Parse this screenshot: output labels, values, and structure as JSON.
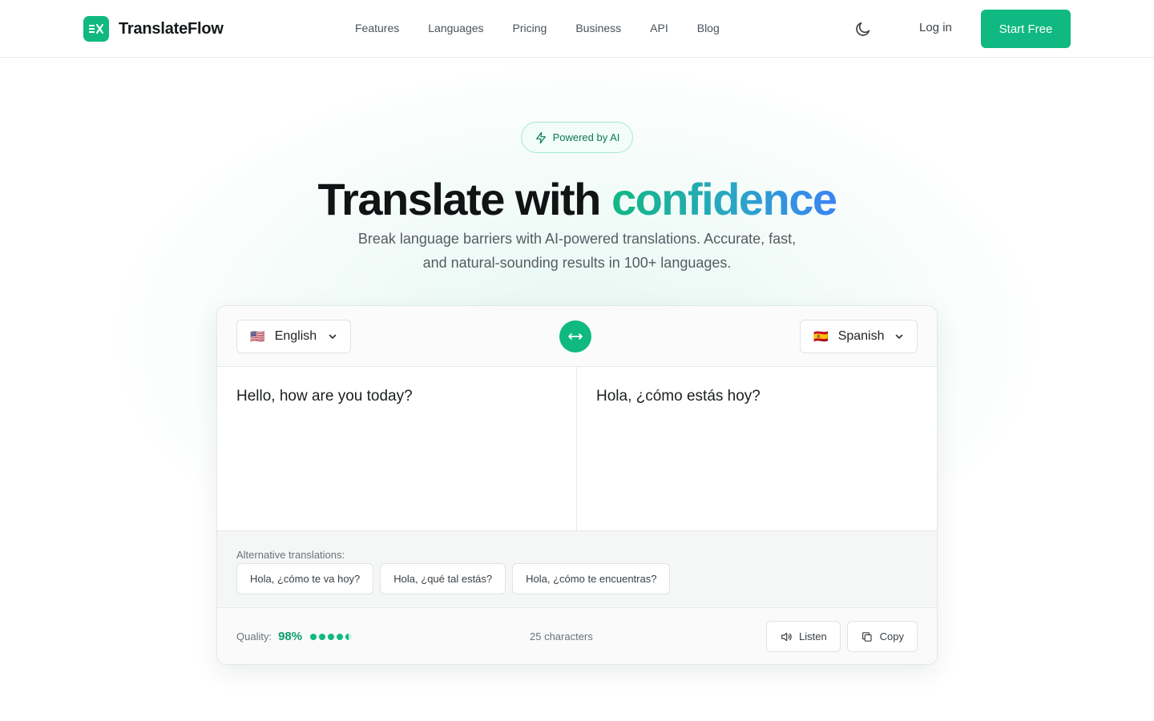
{
  "brand": {
    "name": "TranslateFlow",
    "logo_icon": "translate-icon"
  },
  "nav": {
    "links": [
      "Features",
      "Languages",
      "Pricing",
      "Business",
      "API",
      "Blog"
    ],
    "login": "Log in",
    "cta": "Start Free",
    "theme_icon": "moon-icon"
  },
  "hero": {
    "badge": "Powered by AI",
    "title_main": "Translate with ",
    "title_accent": "confidence",
    "subtitle_line1": "Break language barriers with AI-powered translations. Accurate, fast,",
    "subtitle_line2": "and natural-sounding results in 100+ languages."
  },
  "translator": {
    "source_lang": {
      "flag": "🇺🇸",
      "name": "English"
    },
    "target_lang": {
      "flag": "🇪🇸",
      "name": "Spanish"
    },
    "source_text": "Hello, how are you today?",
    "target_text": "Hola, ¿cómo estás hoy?",
    "alternatives_label": "Alternative translations:",
    "alternatives": [
      "Hola, ¿cómo te va hoy?",
      "Hola, ¿qué tal estás?",
      "Hola, ¿cómo te encuentras?"
    ],
    "quality_label": "Quality:",
    "quality_value": "98%",
    "quality_rating": 4.5,
    "char_count": "25 characters",
    "listen_label": "Listen",
    "copy_label": "Copy"
  },
  "colors": {
    "accent": "#10b981",
    "accent_dark": "#0f9d6c",
    "gradient_end": "#3b82f6"
  }
}
